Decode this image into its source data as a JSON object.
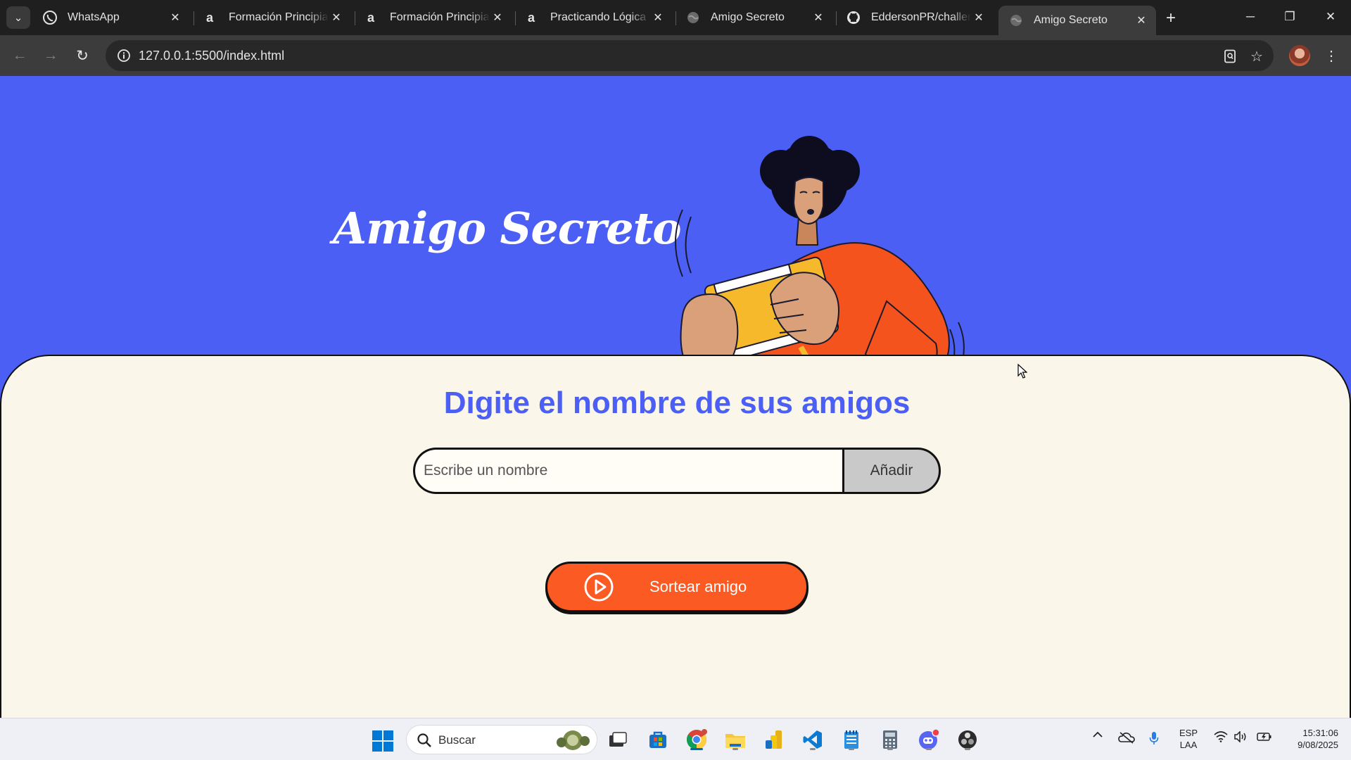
{
  "browser": {
    "tabs": [
      {
        "title": "WhatsApp",
        "icon": "whatsapp-icon"
      },
      {
        "title": "Formación Principiante",
        "icon": "alura-icon"
      },
      {
        "title": "Formación Principiante",
        "icon": "alura-icon"
      },
      {
        "title": "Practicando Lógica de",
        "icon": "alura-icon"
      },
      {
        "title": "Amigo Secreto",
        "icon": "globe-icon"
      },
      {
        "title": "EddersonPR/challenge",
        "icon": "github-icon"
      },
      {
        "title": "Amigo Secreto",
        "icon": "globe-icon",
        "active": true
      }
    ],
    "url": "127.0.0.1:5500/index.html"
  },
  "page": {
    "hero_title": "Amigo Secreto",
    "section_title": "Digite el nombre de sus amigos",
    "input_placeholder": "Escribe un nombre",
    "add_button": "Añadir",
    "draw_button": "Sortear amigo",
    "colors": {
      "primary": "#4b5ff5",
      "accent": "#fb5a22",
      "card": "#fbf6ea"
    }
  },
  "taskbar": {
    "search_placeholder": "Buscar",
    "language": {
      "line1": "ESP",
      "line2": "LAA"
    },
    "clock": {
      "time": "15:31:06",
      "date": "9/08/2025"
    }
  }
}
